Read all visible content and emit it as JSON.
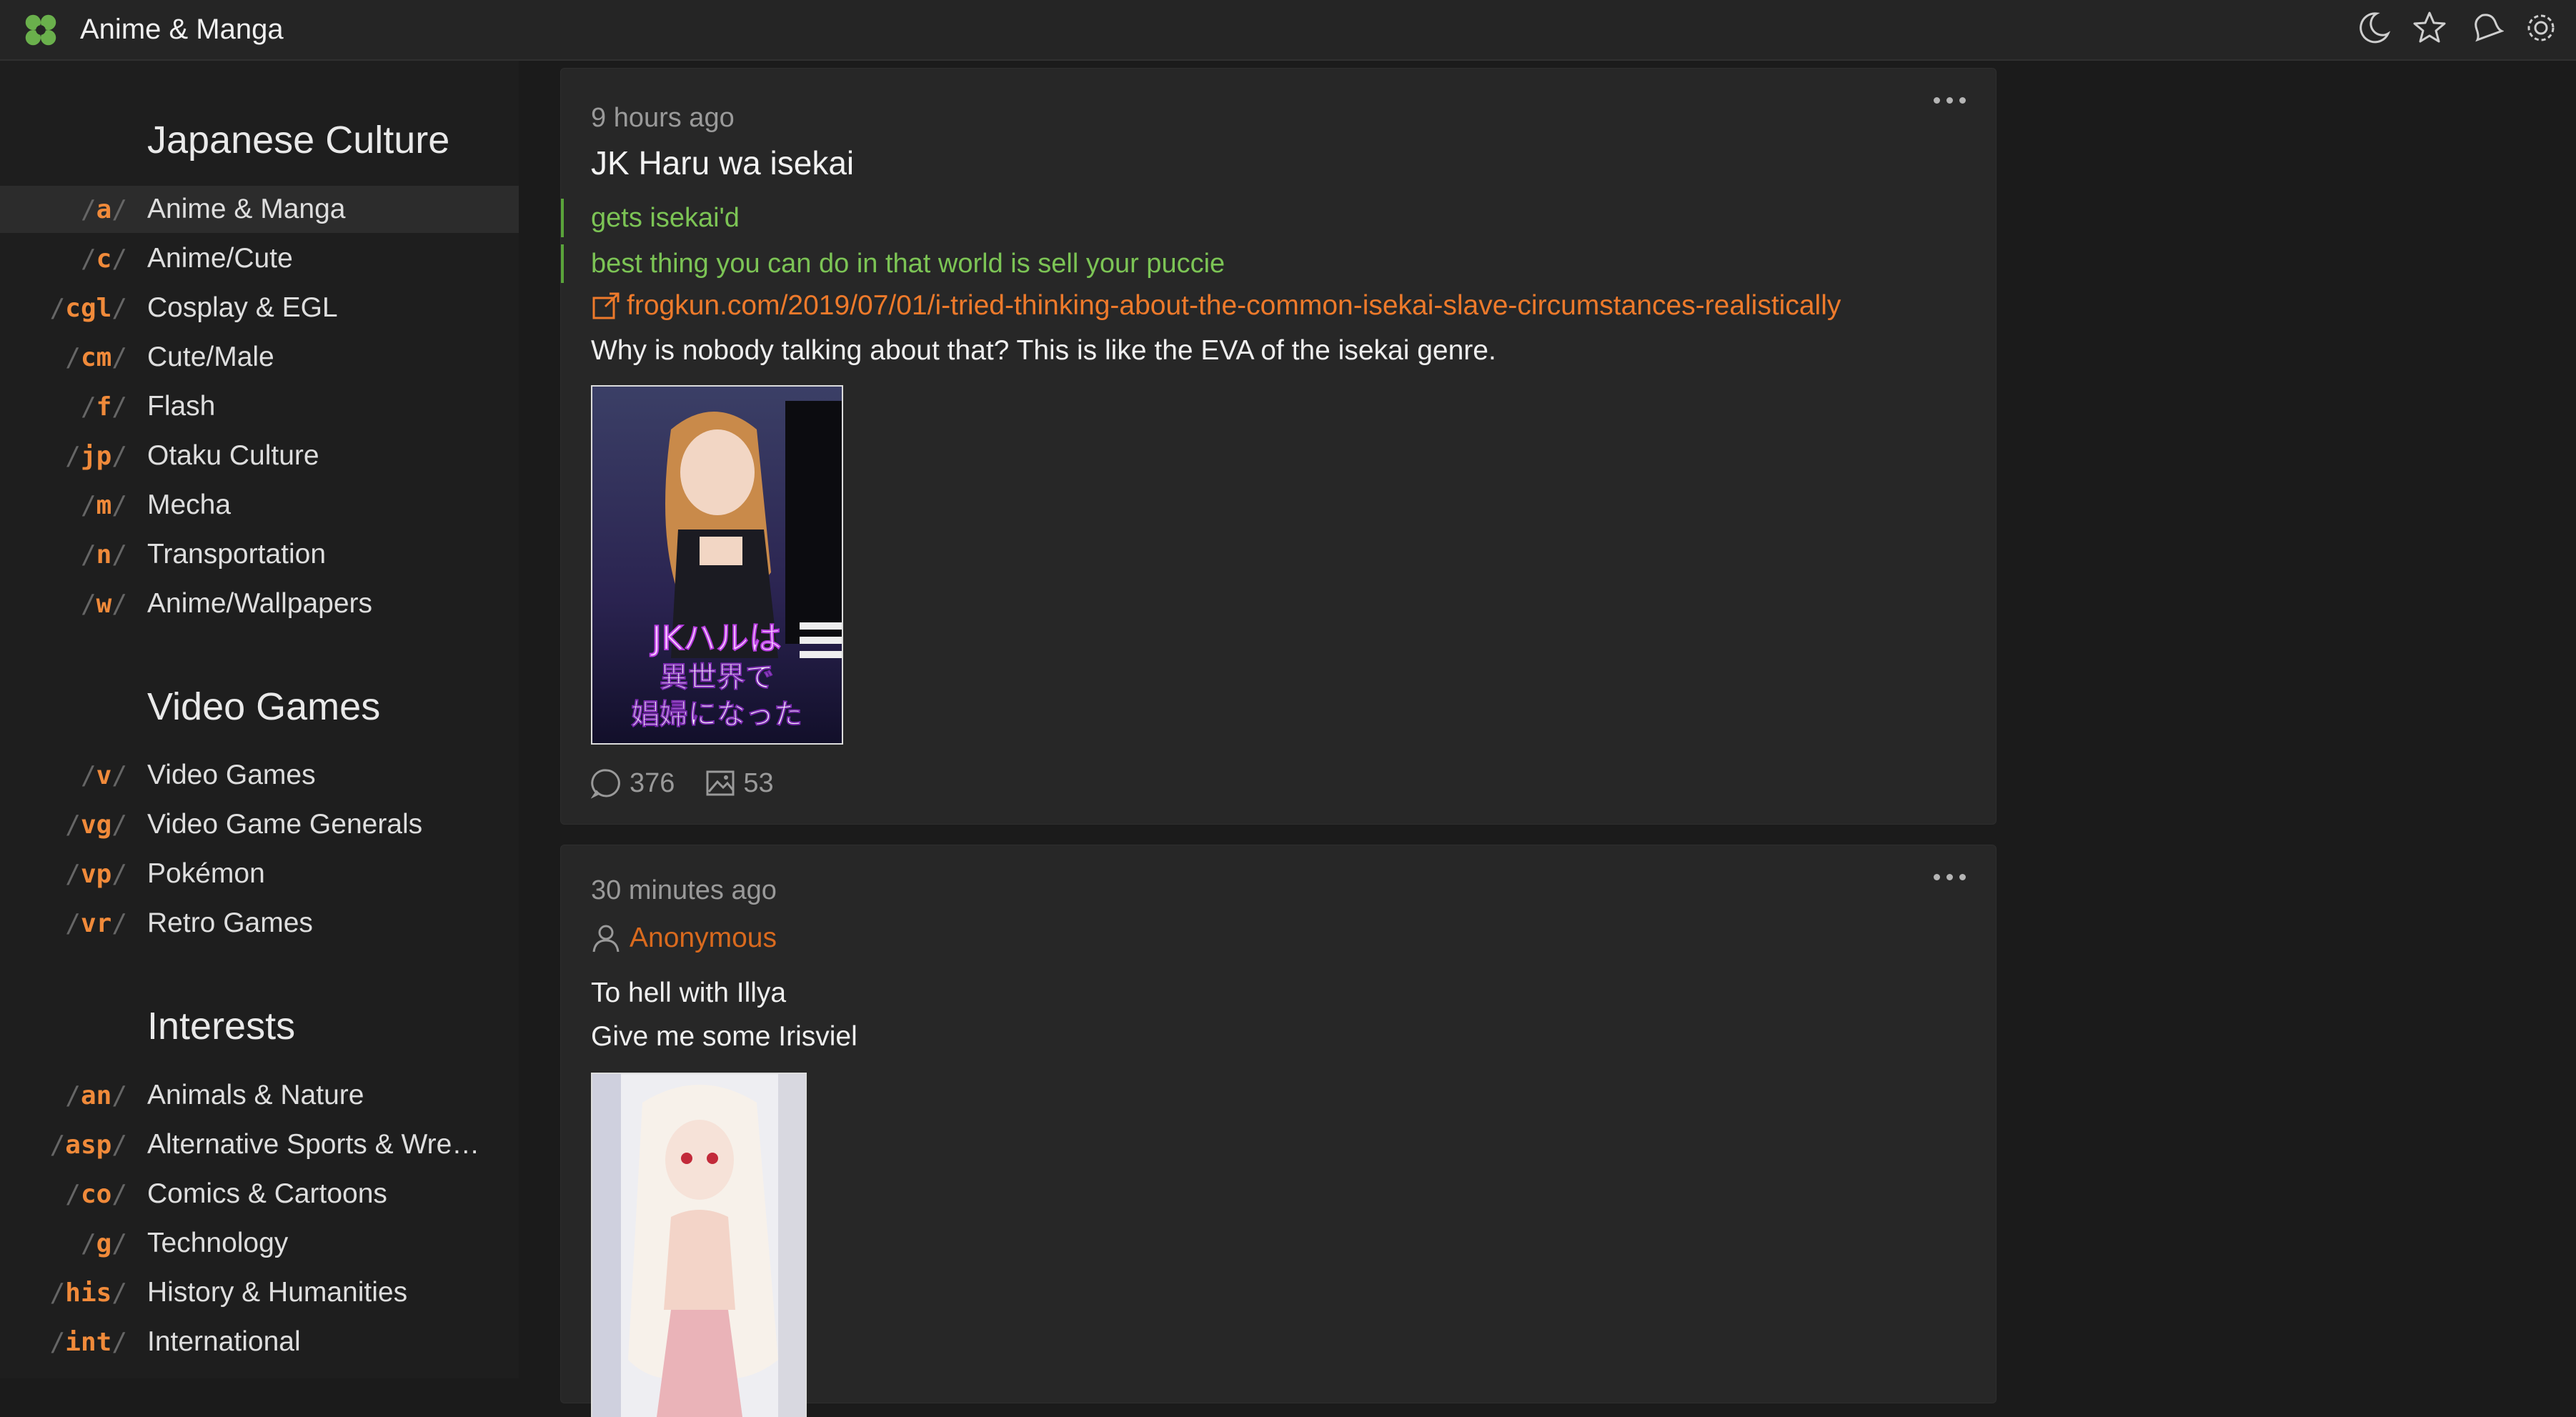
{
  "app": {
    "title": "Anime & Manga"
  },
  "colors": {
    "accent": "#f08a3a",
    "link": "#ee7a2b",
    "greentext": "#7cc455",
    "brand_logo": "#6ab04c"
  },
  "topbar_icons": [
    "moon-icon",
    "star-icon",
    "bell-icon",
    "gear-icon"
  ],
  "sidebar": {
    "sections": [
      {
        "title": "Japanese Culture",
        "boards": [
          {
            "code": "a",
            "name": "Anime & Manga",
            "active": true
          },
          {
            "code": "c",
            "name": "Anime/Cute"
          },
          {
            "code": "cgl",
            "name": "Cosplay & EGL"
          },
          {
            "code": "cm",
            "name": "Cute/Male"
          },
          {
            "code": "f",
            "name": "Flash"
          },
          {
            "code": "jp",
            "name": "Otaku Culture"
          },
          {
            "code": "m",
            "name": "Mecha"
          },
          {
            "code": "n",
            "name": "Transportation"
          },
          {
            "code": "w",
            "name": "Anime/Wallpapers"
          }
        ]
      },
      {
        "title": "Video Games",
        "boards": [
          {
            "code": "v",
            "name": "Video Games"
          },
          {
            "code": "vg",
            "name": "Video Game Generals"
          },
          {
            "code": "vp",
            "name": "Pokémon"
          },
          {
            "code": "vr",
            "name": "Retro Games"
          }
        ]
      },
      {
        "title": "Interests",
        "boards": [
          {
            "code": "an",
            "name": "Animals & Nature"
          },
          {
            "code": "asp",
            "name": "Alternative Sports & Wre…"
          },
          {
            "code": "co",
            "name": "Comics & Cartoons"
          },
          {
            "code": "g",
            "name": "Technology"
          },
          {
            "code": "his",
            "name": "History & Humanities"
          },
          {
            "code": "int",
            "name": "International"
          }
        ]
      }
    ]
  },
  "threads": [
    {
      "time": "9 hours ago",
      "title": "JK Haru wa isekai",
      "greentext": [
        "gets isekai'd",
        "best thing you can do in that world is sell your puccie"
      ],
      "link": "frogkun.com/2019/07/01/i-tried-thinking-about-the-common-isekai-slave-circumstances-realistically",
      "body": "Why is nobody talking about that? This is like the EVA of the isekai genre.",
      "thumbnail_caption": "JKハルは 異世界で 娼婦になった",
      "replies": "376",
      "images": "53"
    },
    {
      "time": "30 minutes ago",
      "author": "Anonymous",
      "body_lines": [
        "To hell with Illya",
        "Give me some Irisviel"
      ]
    }
  ]
}
